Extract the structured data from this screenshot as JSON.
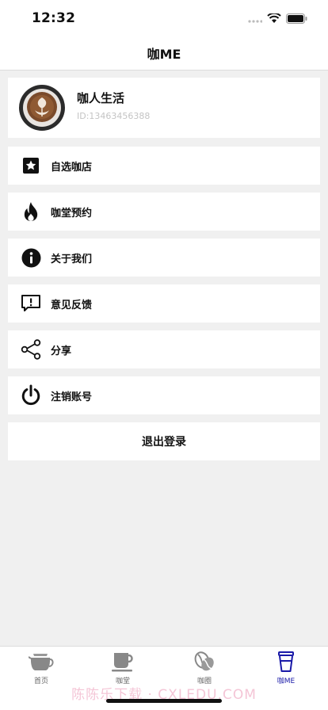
{
  "status_bar": {
    "time": "12:32"
  },
  "nav": {
    "title": "咖ME"
  },
  "profile": {
    "name": "咖人生活",
    "id_text": "ID:13463456388"
  },
  "menu": [
    {
      "label": "自选咖店",
      "icon": "star-icon"
    },
    {
      "label": "咖堂预约",
      "icon": "flame-icon"
    },
    {
      "label": "关于我们",
      "icon": "info-icon"
    },
    {
      "label": "意见反馈",
      "icon": "feedback-icon"
    },
    {
      "label": "分享",
      "icon": "share-icon"
    },
    {
      "label": "注销账号",
      "icon": "power-icon"
    }
  ],
  "logout": {
    "label": "退出登录"
  },
  "tabs": [
    {
      "label": "首页",
      "icon": "coffee-pot-icon",
      "active": false
    },
    {
      "label": "咖堂",
      "icon": "coffee-cup-icon",
      "active": false
    },
    {
      "label": "咖圈",
      "icon": "coffee-bean-icon",
      "active": false
    },
    {
      "label": "咖ME",
      "icon": "takeaway-cup-icon",
      "active": true
    }
  ],
  "watermark": "陈陈乐下载 · CXLEDU.COM",
  "colors": {
    "accent": "#1a1aa8",
    "background": "#f0f0f0",
    "card": "#ffffff",
    "muted": "#c4c4c4"
  }
}
